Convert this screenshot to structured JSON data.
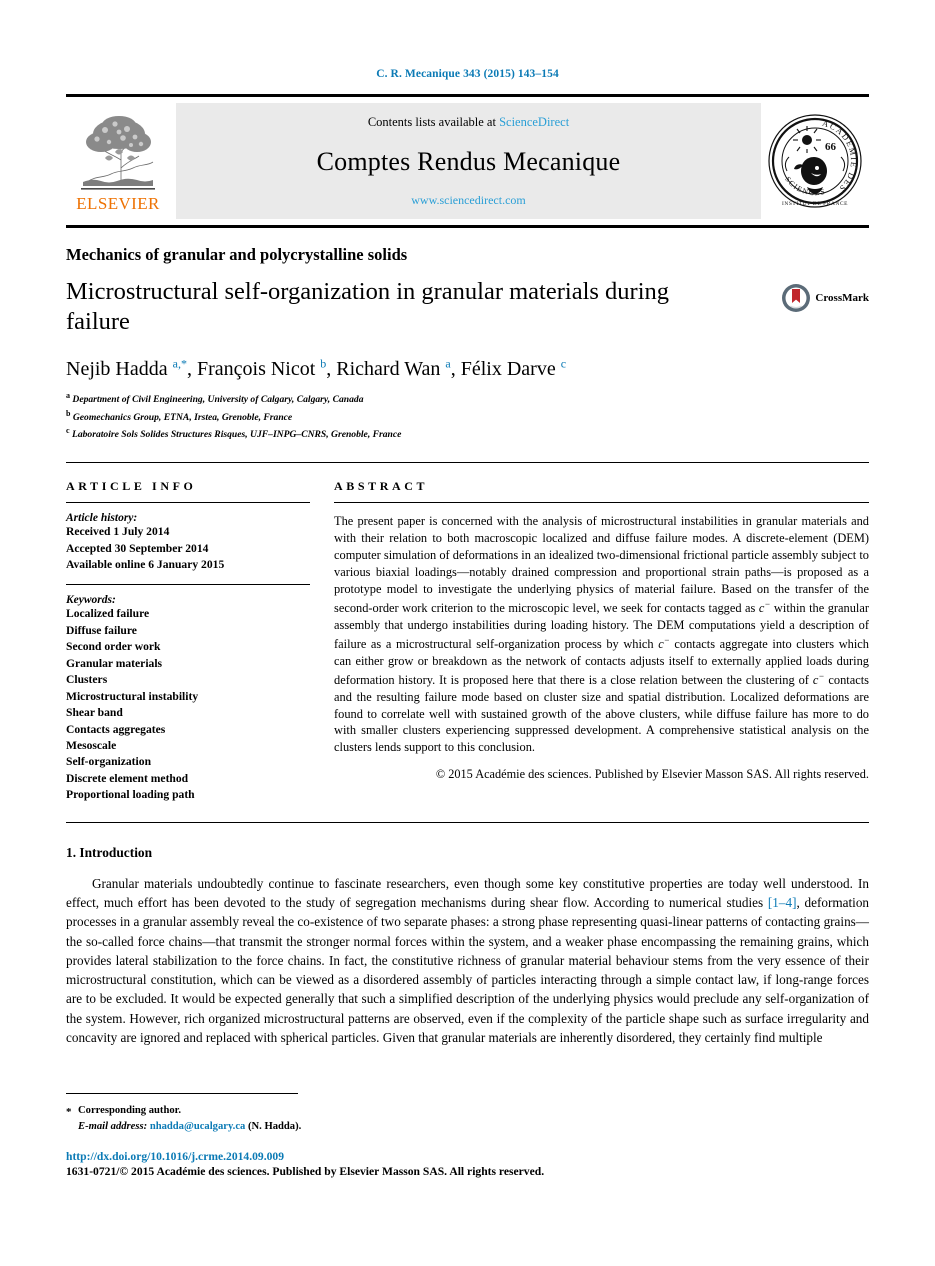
{
  "running_head": "C. R. Mecanique 343 (2015) 143–154",
  "masthead": {
    "publisher_logo_text": "ELSEVIER",
    "contents_prefix": "Contents lists available at ",
    "contents_link": "ScienceDirect",
    "journal_title": "Comptes Rendus Mecanique",
    "journal_url": "www.sciencedirect.com",
    "seal_text_outer": "ACADEMIE DES SCIENCES",
    "seal_text_inner": "INSTITUT DE FRANCE",
    "seal_number": "66"
  },
  "article": {
    "section_label": "Mechanics of granular and polycrystalline solids",
    "title": "Microstructural self-organization in granular materials during failure",
    "crossmark_label": "CrossMark",
    "authors_html": "Nejib Hadda <sup>a,*</sup>, François Nicot <sup>b</sup>, Richard Wan <sup>a</sup>, Félix Darve <sup>c</sup>",
    "affiliations": [
      {
        "marker": "a",
        "text": "Department of Civil Engineering, University of Calgary, Calgary, Canada"
      },
      {
        "marker": "b",
        "text": "Geomechanics Group, ETNA, Irstea, Grenoble, France"
      },
      {
        "marker": "c",
        "text": "Laboratoire Sols Solides Structures Risques, UJF–INPG–CNRS, Grenoble, France"
      }
    ]
  },
  "info": {
    "heading": "ARTICLE INFO",
    "history_heading": "Article history:",
    "history": [
      "Received 1 July 2014",
      "Accepted 30 September 2014",
      "Available online 6 January 2015"
    ],
    "keywords_heading": "Keywords:",
    "keywords": [
      "Localized failure",
      "Diffuse failure",
      "Second order work",
      "Granular materials",
      "Clusters",
      "Microstructural instability",
      "Shear band",
      "Contacts aggregates",
      "Mesoscale",
      "Self-organization",
      "Discrete element method",
      "Proportional loading path"
    ]
  },
  "abstract": {
    "heading": "ABSTRACT",
    "part1": "The present paper is concerned with the analysis of microstructural instabilities in granular materials and with their relation to both macroscopic localized and diffuse failure modes. A discrete-element (DEM) computer simulation of deformations in an idealized two-dimensional frictional particle assembly subject to various biaxial loadings—notably drained compression and proportional strain paths—is proposed as a prototype model to investigate the underlying physics of material failure. Based on the transfer of the second-order work criterion to the microscopic level, we seek for contacts tagged as ",
    "part2": " within the granular assembly that undergo instabilities during loading history. The DEM computations yield a description of failure as a microstructural self-organization process by which ",
    "part3": " contacts aggregate into clusters which can either grow or breakdown as the network of contacts adjusts itself to externally applied loads during deformation history. It is proposed here that there is a close relation between the clustering of ",
    "part4": " contacts and the resulting failure mode based on cluster size and spatial distribution. Localized deformations are found to correlate well with sustained growth of the above clusters, while diffuse failure has more to do with smaller clusters experiencing suppressed development. A comprehensive statistical analysis on the clusters lends support to this conclusion.",
    "contact_symbol": "c",
    "contact_superscript": "−",
    "copyright": "© 2015 Académie des sciences. Published by Elsevier Masson SAS. All rights reserved."
  },
  "body": {
    "section_number_title": "1. Introduction",
    "paragraph_part1": "Granular materials undoubtedly continue to fascinate researchers, even though some key constitutive properties are today well understood. In effect, much effort has been devoted to the study of segregation mechanisms during shear flow. According to numerical studies ",
    "citation": "[1–4]",
    "paragraph_part2": ", deformation processes in a granular assembly reveal the co-existence of two separate phases: a strong phase representing quasi-linear patterns of contacting grains—the so-called force chains—that transmit the stronger normal forces within the system, and a weaker phase encompassing the remaining grains, which provides lateral stabilization to the force chains. In fact, the constitutive richness of granular material behaviour stems from the very essence of their microstructural constitution, which can be viewed as a disordered assembly of particles interacting through a simple contact law, if long-range forces are to be excluded. It would be expected generally that such a simplified description of the underlying physics would preclude any self-organization of the system. However, rich organized microstructural patterns are observed, even if the complexity of the particle shape such as surface irregularity and concavity are ignored and replaced with spherical particles. Given that granular materials are inherently disordered, they certainly find multiple"
  },
  "footer": {
    "corresponding_author": "Corresponding author.",
    "email_label": "E-mail address:",
    "email": "nhadda@ucalgary.ca",
    "email_suffix": "(N. Hadda).",
    "doi": "http://dx.doi.org/10.1016/j.crme.2014.09.009",
    "issn_line": "1631-0721/© 2015 Académie des sciences. Published by Elsevier Masson SAS. All rights reserved."
  },
  "colors": {
    "link_blue": "#0b7ab5",
    "sciencedirect_blue": "#2a9fd6",
    "elsevier_orange": "#ee7203",
    "banner_gray": "#eaeaea"
  }
}
